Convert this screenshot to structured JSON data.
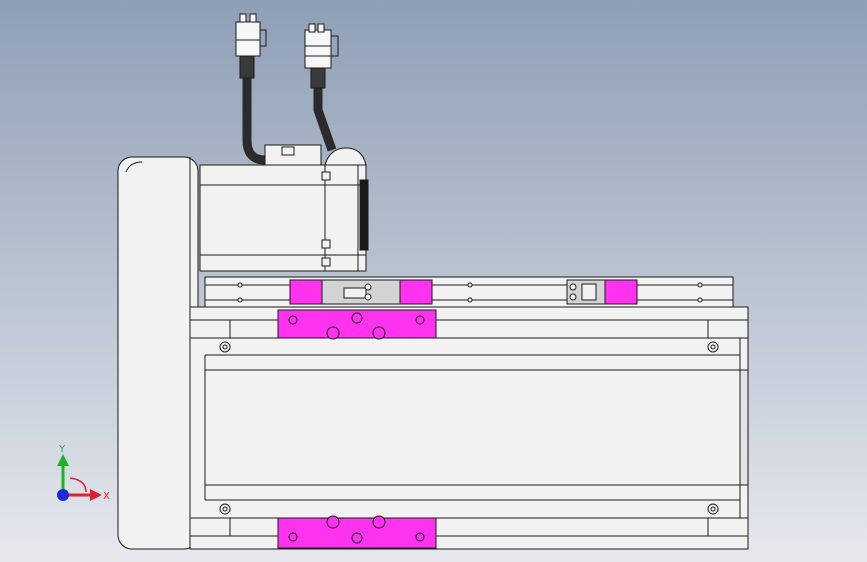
{
  "viewport": {
    "background_top": "#8e9fb6",
    "background_bottom": "#e6e8ed"
  },
  "triad": {
    "x_label": "X",
    "y_label": "Y",
    "x_color": "#e0202a",
    "y_color": "#1fb02a",
    "z_color": "#1a2ad8"
  },
  "colors": {
    "body": "#f2f2f2",
    "edge": "#1a1a1a",
    "magenta": "#ff33ee",
    "cable": "#2b2b2b",
    "slider_gray": "#d3d3d3"
  }
}
